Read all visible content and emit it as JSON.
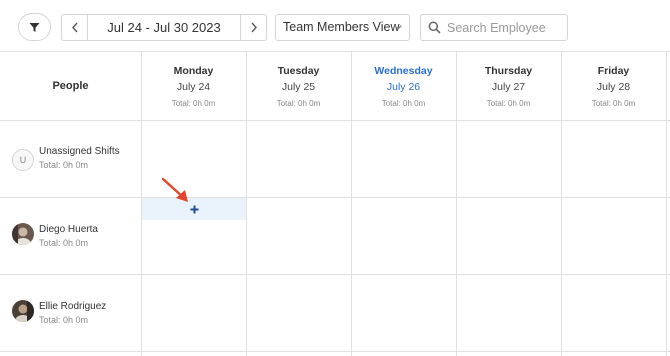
{
  "toolbar": {
    "filter_icon": "filter-icon",
    "date_range": "Jul 24 - Jul 30 2023",
    "view_label": "Team Members View",
    "search_placeholder": "Search Employee"
  },
  "schedule": {
    "people_header": "People",
    "days": [
      {
        "name": "Monday",
        "date": "July 24",
        "total": "Total: 0h 0m",
        "today": false
      },
      {
        "name": "Tuesday",
        "date": "July 25",
        "total": "Total: 0h 0m",
        "today": false
      },
      {
        "name": "Wednesday",
        "date": "July 26",
        "total": "Total: 0h 0m",
        "today": true
      },
      {
        "name": "Thursday",
        "date": "July 27",
        "total": "Total: 0h 0m",
        "today": false
      },
      {
        "name": "Friday",
        "date": "July 28",
        "total": "Total: 0h 0m",
        "today": false
      }
    ],
    "people": [
      {
        "name": "Unassigned Shifts",
        "total": "Total: 0h 0m",
        "avatar_initial": "U"
      },
      {
        "name": "Diego Huerta",
        "total": "Total: 0h 0m"
      },
      {
        "name": "Ellie Rodriguez",
        "total": "Total: 0h 0m"
      }
    ]
  },
  "colors": {
    "accent": "#2a6fcf",
    "add_cell_bg": "#eaf2fb",
    "add_icon": "#1f4f9a",
    "annotation_arrow": "#e2462c"
  }
}
